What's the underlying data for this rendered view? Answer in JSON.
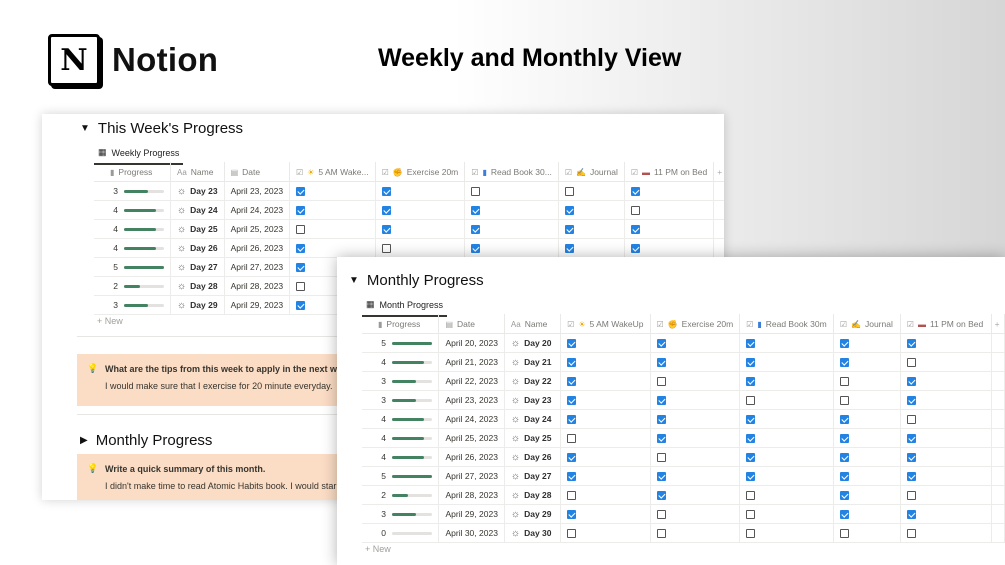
{
  "brand": {
    "logo_letter": "N",
    "name": "Notion"
  },
  "headline": "Weekly and Monthly View",
  "weekly": {
    "title": "This Week's Progress",
    "tab": "Weekly Progress",
    "columns": {
      "progress": "Progress",
      "name": "Name",
      "date": "Date",
      "wake": "5 AM Wake...",
      "exercise": "Exercise 20m",
      "read": "Read Book 30...",
      "journal": "Journal",
      "bed": "11 PM on Bed",
      "add": "+"
    },
    "rows": [
      {
        "progress": 3,
        "name": "Day 23",
        "date": "April 23, 2023",
        "wake": true,
        "exercise": true,
        "read": false,
        "journal": false,
        "bed": true
      },
      {
        "progress": 4,
        "name": "Day 24",
        "date": "April 24, 2023",
        "wake": true,
        "exercise": true,
        "read": true,
        "journal": true,
        "bed": false
      },
      {
        "progress": 4,
        "name": "Day 25",
        "date": "April 25, 2023",
        "wake": false,
        "exercise": true,
        "read": true,
        "journal": true,
        "bed": true
      },
      {
        "progress": 4,
        "name": "Day 26",
        "date": "April 26, 2023",
        "wake": true,
        "exercise": false,
        "read": true,
        "journal": true,
        "bed": true
      },
      {
        "progress": 5,
        "name": "Day 27",
        "date": "April 27, 2023",
        "wake": true,
        "exercise": null,
        "read": null,
        "journal": null,
        "bed": null
      },
      {
        "progress": 2,
        "name": "Day 28",
        "date": "April 28, 2023",
        "wake": false,
        "exercise": null,
        "read": null,
        "journal": null,
        "bed": null
      },
      {
        "progress": 3,
        "name": "Day 29",
        "date": "April 29, 2023",
        "wake": true,
        "exercise": null,
        "read": null,
        "journal": null,
        "bed": null
      }
    ],
    "new_label": "+ New",
    "callout": {
      "question": "What are the tips from this week to apply in the next wee",
      "answer": "I would make sure that I exercise for 20 minute everyday."
    }
  },
  "monthly_collapsed": {
    "title": "Monthly Progress",
    "callout": {
      "question": "Write a quick summary of this month.",
      "answer": "I didn't make time to read Atomic Habits book. I would star"
    }
  },
  "monthly": {
    "title": "Monthly Progress",
    "tab": "Month Progress",
    "columns": {
      "progress": "Progress",
      "date": "Date",
      "name": "Name",
      "wake": "5 AM WakeUp",
      "exercise": "Exercise 20m",
      "read": "Read Book 30m",
      "journal": "Journal",
      "bed": "11 PM on Bed",
      "add": "+"
    },
    "rows": [
      {
        "progress": 5,
        "date": "April 20, 2023",
        "name": "Day 20",
        "wake": true,
        "exercise": true,
        "read": true,
        "journal": true,
        "bed": true
      },
      {
        "progress": 4,
        "date": "April 21, 2023",
        "name": "Day 21",
        "wake": true,
        "exercise": true,
        "read": true,
        "journal": true,
        "bed": false
      },
      {
        "progress": 3,
        "date": "April 22, 2023",
        "name": "Day 22",
        "wake": true,
        "exercise": false,
        "read": true,
        "journal": false,
        "bed": true
      },
      {
        "progress": 3,
        "date": "April 23, 2023",
        "name": "Day 23",
        "wake": true,
        "exercise": true,
        "read": false,
        "journal": false,
        "bed": true
      },
      {
        "progress": 4,
        "date": "April 24, 2023",
        "name": "Day 24",
        "wake": true,
        "exercise": true,
        "read": true,
        "journal": true,
        "bed": false
      },
      {
        "progress": 4,
        "date": "April 25, 2023",
        "name": "Day 25",
        "wake": false,
        "exercise": true,
        "read": true,
        "journal": true,
        "bed": true
      },
      {
        "progress": 4,
        "date": "April 26, 2023",
        "name": "Day 26",
        "wake": true,
        "exercise": false,
        "read": true,
        "journal": true,
        "bed": true
      },
      {
        "progress": 5,
        "date": "April 27, 2023",
        "name": "Day 27",
        "wake": true,
        "exercise": true,
        "read": true,
        "journal": true,
        "bed": true
      },
      {
        "progress": 2,
        "date": "April 28, 2023",
        "name": "Day 28",
        "wake": false,
        "exercise": true,
        "read": false,
        "journal": true,
        "bed": false
      },
      {
        "progress": 3,
        "date": "April 29, 2023",
        "name": "Day 29",
        "wake": true,
        "exercise": false,
        "read": false,
        "journal": true,
        "bed": true
      },
      {
        "progress": 0,
        "date": "April 30, 2023",
        "name": "Day 30",
        "wake": false,
        "exercise": false,
        "read": false,
        "journal": false,
        "bed": false
      }
    ],
    "new_label": "+ New"
  },
  "progress_max": 5,
  "icons": {
    "toggle": "triangle-down",
    "table": "table-icon",
    "sun": "sun-icon",
    "bulb": "lightbulb-icon"
  },
  "colors": {
    "check": "#2383e2",
    "bar": "#448361",
    "callout": "#fbdcc4"
  }
}
